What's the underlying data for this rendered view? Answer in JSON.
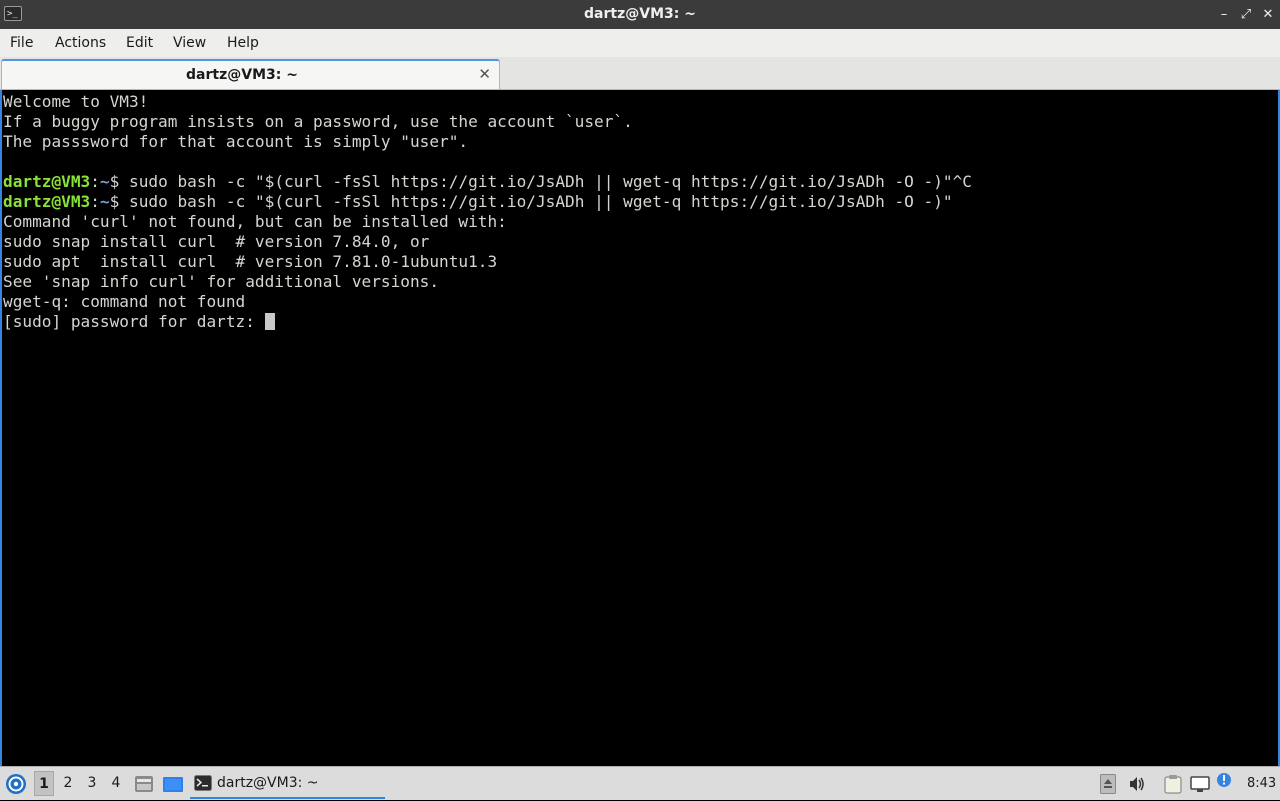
{
  "window": {
    "title": "dartz@VM3: ~",
    "app_icon_glyph": ">_",
    "controls": {
      "minimize": "–",
      "maximize": "⤢",
      "close": "✕"
    }
  },
  "menubar": {
    "items": [
      "File",
      "Actions",
      "Edit",
      "View",
      "Help"
    ]
  },
  "tabs": [
    {
      "label": "dartz@VM3: ~",
      "close_glyph": "✕",
      "active": true
    }
  ],
  "terminal": {
    "colors": {
      "background": "#000000",
      "text": "#d3d7cf",
      "user": "#8ae234",
      "path": "#729fcf"
    },
    "lines": [
      {
        "text": "Welcome to VM3!"
      },
      {
        "text": "If a buggy program insists on a password, use the account `user`."
      },
      {
        "text": "The passsword for that account is simply \"user\"."
      },
      {
        "text": ""
      },
      {
        "prompt": {
          "user": "dartz@VM3",
          "sep": ":",
          "path": "~",
          "sigil": "$ "
        },
        "text": "sudo bash -c \"$(curl -fsSl https://git.io/JsADh || wget-q https://git.io/JsADh -O -)\"^C"
      },
      {
        "prompt": {
          "user": "dartz@VM3",
          "sep": ":",
          "path": "~",
          "sigil": "$ "
        },
        "text": "sudo bash -c \"$(curl -fsSl https://git.io/JsADh || wget-q https://git.io/JsADh -O -)\""
      },
      {
        "text": "Command 'curl' not found, but can be installed with:"
      },
      {
        "text": "sudo snap install curl  # version 7.84.0, or"
      },
      {
        "text": "sudo apt  install curl  # version 7.81.0-1ubuntu1.3"
      },
      {
        "text": "See 'snap info curl' for additional versions."
      },
      {
        "text": "wget-q: command not found"
      },
      {
        "text": "[sudo] password for dartz: ",
        "cursor": true
      }
    ]
  },
  "taskbar": {
    "start_icon": "lubuntu-start-icon",
    "workspaces": [
      {
        "label": "1",
        "active": true
      },
      {
        "label": "2",
        "active": false
      },
      {
        "label": "3",
        "active": false
      },
      {
        "label": "4",
        "active": false
      }
    ],
    "quicklaunch": [
      "file-manager-icon",
      "show-desktop-icon"
    ],
    "tasks": [
      {
        "label": "dartz@VM3: ~",
        "icon": "terminal-icon"
      }
    ],
    "tray": [
      "eject-icon",
      "volume-icon",
      "clipboard-icon",
      "network-icon",
      "update-notifier-icon"
    ],
    "clock": "8:43"
  }
}
